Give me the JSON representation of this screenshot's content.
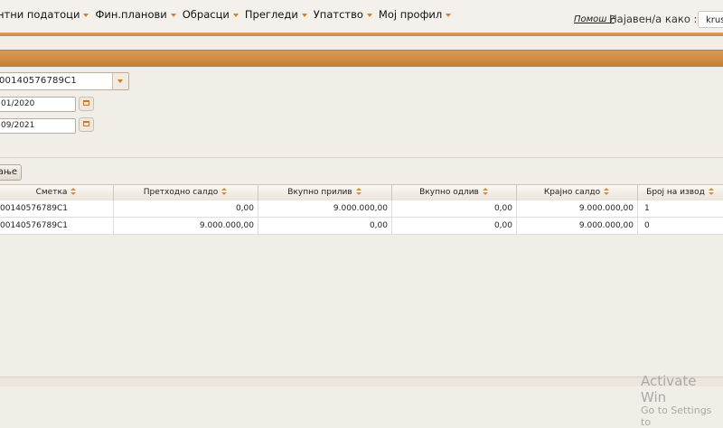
{
  "nav": {
    "items": [
      {
        "label": "нтни податоци"
      },
      {
        "label": "Фин.планови"
      },
      {
        "label": "Обрасци"
      },
      {
        "label": "Прегледи"
      },
      {
        "label": "Упатство"
      },
      {
        "label": "Мој профил"
      }
    ],
    "help_label": "Помош ?",
    "logged_in_label": "Најавен/а како :",
    "username": "krus"
  },
  "filters": {
    "account_value": "00140576789C1",
    "date_from": "01/2020",
    "date_to": "09/2021",
    "search_button_label": "ање"
  },
  "grid": {
    "columns": [
      "Сметка",
      "Претходно салдо",
      "Вкупно прилив",
      "Вкупно одлив",
      "Крајно салдо",
      "Број на извод"
    ],
    "rows": [
      {
        "account": "00140576789C1",
        "prev_balance": "0,00",
        "inflow": "9.000.000,00",
        "outflow": "0,00",
        "end_balance": "9.000.000,00",
        "statement_no": "1"
      },
      {
        "account": "00140576789C1",
        "prev_balance": "9.000.000,00",
        "inflow": "0,00",
        "outflow": "0,00",
        "end_balance": "9.000.000,00",
        "statement_no": "0"
      }
    ]
  },
  "watermark": {
    "line1": "Activate Win",
    "line2": "Go to Settings to"
  },
  "colors": {
    "accent": "#d9822b",
    "header_band": "#d08b42",
    "background": "#f1eee8"
  }
}
